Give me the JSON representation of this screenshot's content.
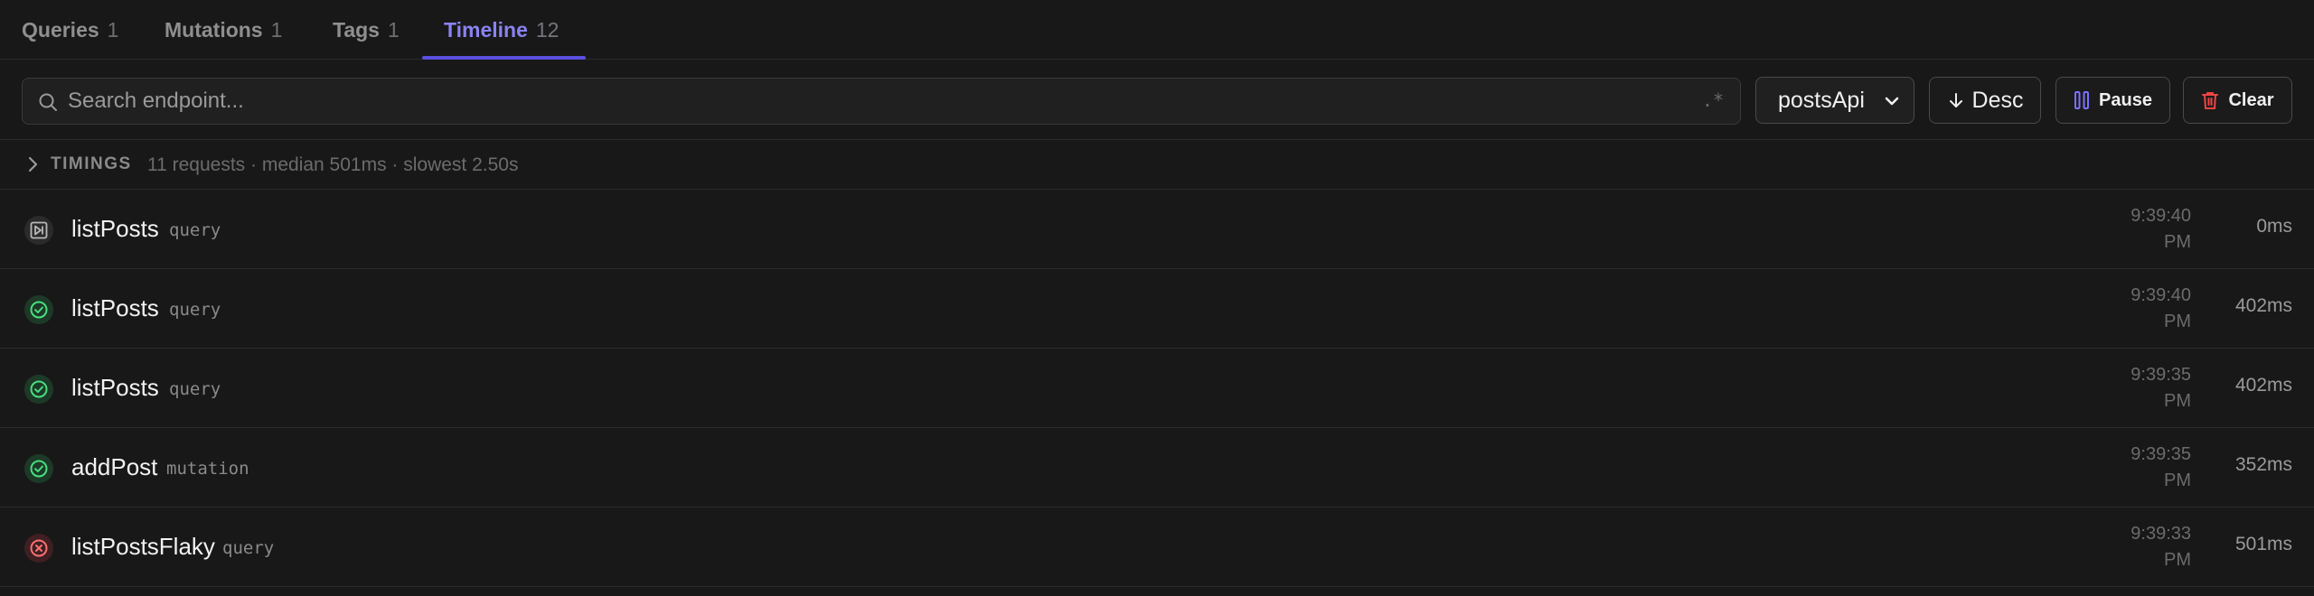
{
  "tabs": [
    {
      "label": "Queries",
      "count": "1"
    },
    {
      "label": "Mutations",
      "count": "1"
    },
    {
      "label": "Tags",
      "count": "1"
    },
    {
      "label": "Timeline",
      "count": "12",
      "active": true
    }
  ],
  "toolbar": {
    "search_placeholder": "Search endpoint...",
    "search_value": "",
    "regex_label": ".*",
    "api_select": "postsApi",
    "sort_label": "Desc",
    "pause_label": "Pause",
    "clear_label": "Clear"
  },
  "timings": {
    "label": "TIMINGS",
    "summary": "11 requests · median 501ms · slowest 2.50s"
  },
  "rows": [
    {
      "status": "pending",
      "name": "listPosts",
      "type": "query",
      "time": "9:39:40",
      "ampm": "PM",
      "duration": "0ms"
    },
    {
      "status": "success",
      "name": "listPosts",
      "type": "query",
      "time": "9:39:40",
      "ampm": "PM",
      "duration": "402ms"
    },
    {
      "status": "success",
      "name": "listPosts",
      "type": "query",
      "time": "9:39:35",
      "ampm": "PM",
      "duration": "402ms"
    },
    {
      "status": "success",
      "name": "addPost",
      "type": "mutation",
      "time": "9:39:35",
      "ampm": "PM",
      "duration": "352ms"
    },
    {
      "status": "error",
      "name": "listPostsFlaky",
      "type": "query",
      "time": "9:39:33",
      "ampm": "PM",
      "duration": "501ms"
    }
  ],
  "colors": {
    "accent": "#8a83f0",
    "underline": "#5b4fe0",
    "success": "#4ade80",
    "error": "#f87171",
    "pause_icon": "#7c72ff",
    "clear_icon": "#ef4444"
  },
  "icons": {
    "search": "search-icon",
    "select": "chevron-down-icon",
    "sort": "arrow-down-icon",
    "pause": "pause-icon",
    "clear": "trash-icon",
    "timings": "chevron-right-icon",
    "pending": "skip-forward-icon",
    "success": "check-circle-icon",
    "error": "x-circle-icon"
  }
}
